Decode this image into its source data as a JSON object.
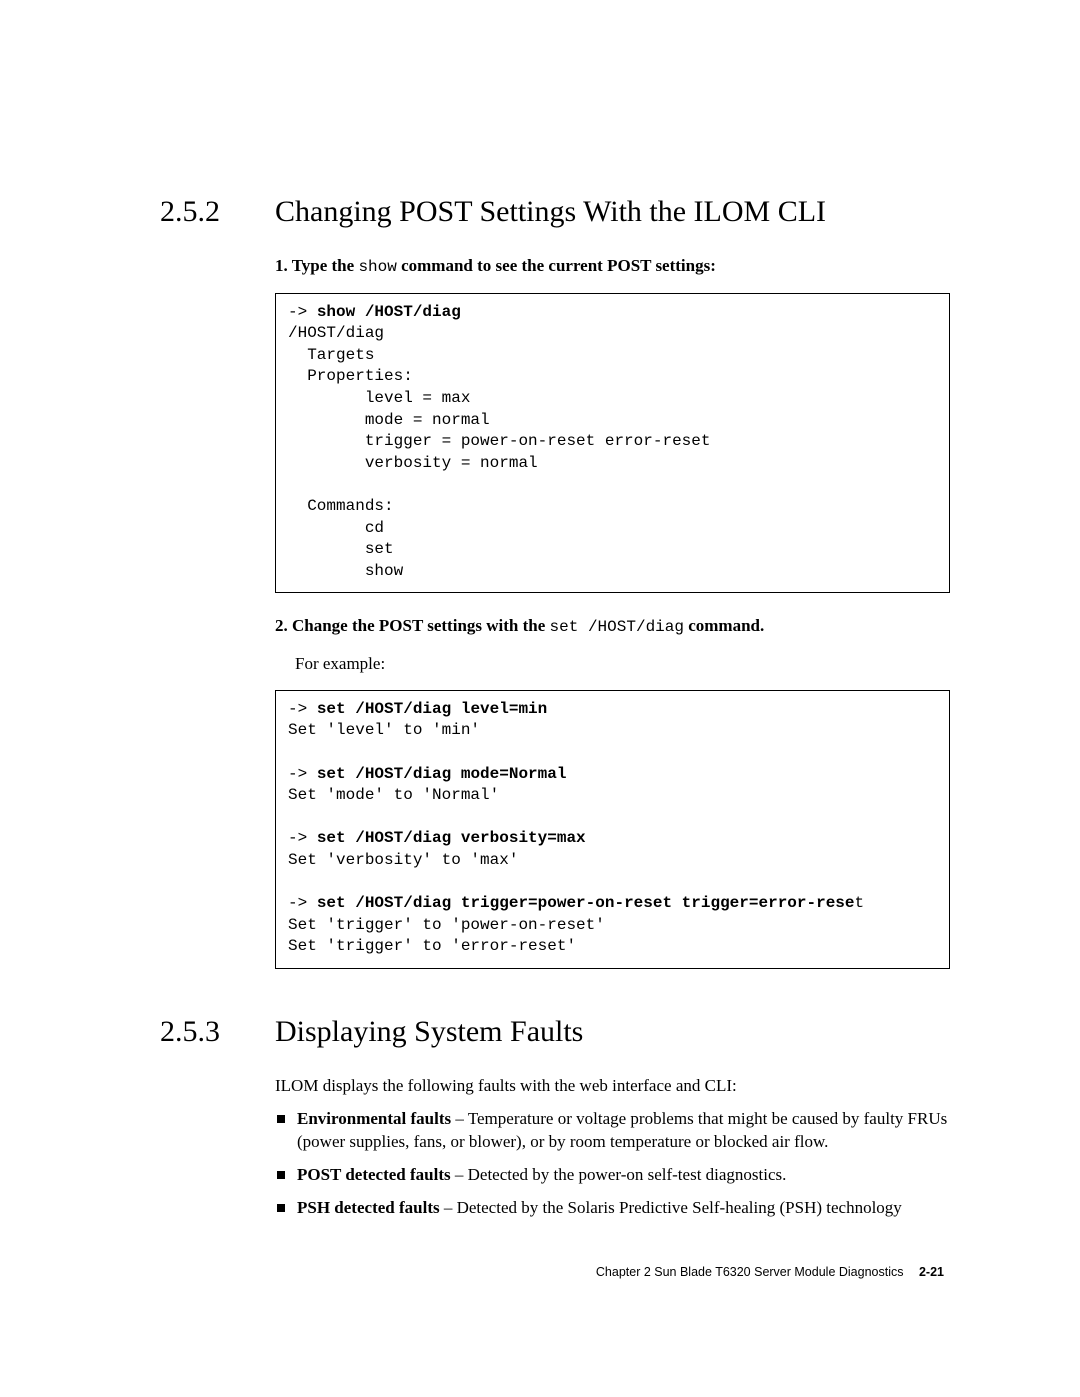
{
  "sections": {
    "s1": {
      "number": "2.5.2",
      "title": "Changing POST Settings With the ILOM CLI"
    },
    "s2": {
      "number": "2.5.3",
      "title": "Displaying System Faults"
    }
  },
  "step1": {
    "prefix": "1. Type the ",
    "mono": "show",
    "suffix": " command to see the current POST settings:"
  },
  "code1": {
    "l1": "-> ",
    "l1b": "show /HOST/diag",
    "l2": "/HOST/diag",
    "l3": "  Targets",
    "l4": "  Properties:",
    "l5": "        level = max",
    "l6": "        mode = normal",
    "l7": "        trigger = power-on-reset error-reset",
    "l8": "        verbosity = normal",
    "l9": "",
    "l10": "  Commands:",
    "l11": "        cd",
    "l12": "        set",
    "l13": "        show"
  },
  "step2": {
    "prefix": "2. Change the POST settings with the ",
    "mono": "set /HOST/diag",
    "suffix": " command.",
    "example": "For example:"
  },
  "code2": {
    "l1a": "-> ",
    "l1b": "set /HOST/diag level=min",
    "l2": "Set 'level' to 'min'",
    "l3": "",
    "l4a": "-> ",
    "l4b": "set /HOST/diag mode=Normal",
    "l5": "Set 'mode' to 'Normal'",
    "l6": "",
    "l7a": "-> ",
    "l7b": "set /HOST/diag verbosity=max",
    "l8": "Set 'verbosity' to 'max'",
    "l9": "",
    "l10a": "-> ",
    "l10b": "set /HOST/diag trigger=power-on-reset trigger=error-rese",
    "l10c": "t",
    "l11": "Set 'trigger' to 'power-on-reset'",
    "l12": "Set 'trigger' to 'error-reset'"
  },
  "s2para": "ILOM displays the following faults with the web interface and CLI:",
  "bullets": {
    "b1": {
      "bold": "Environmental faults",
      "rest": " – Temperature or voltage problems that might be caused by faulty FRUs (power supplies, fans, or blower), or by room temperature or blocked air flow."
    },
    "b2": {
      "bold": "POST detected faults",
      "rest": " – Detected by the power-on self-test diagnostics."
    },
    "b3": {
      "bold": "PSH detected faults",
      "rest": " – Detected by the Solaris Predictive Self-healing (PSH) technology"
    }
  },
  "footer": {
    "chapter": "Chapter 2   Sun Blade T6320 Server Module Diagnostics",
    "page": "2-21"
  }
}
